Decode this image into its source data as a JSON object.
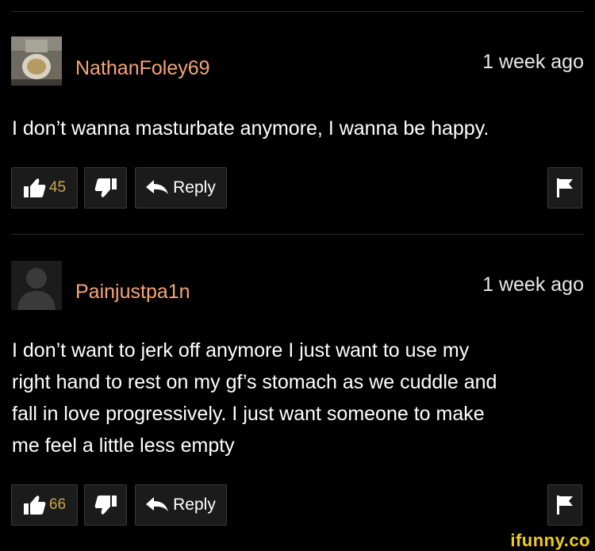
{
  "comments": [
    {
      "username": "NathanFoley69",
      "timestamp": "1 week ago",
      "text": "I don’t wanna masturbate anymore, I wanna be happy.",
      "likes": "45",
      "reply_label": "Reply"
    },
    {
      "username": "Painjustpa1n",
      "timestamp": "1 week ago",
      "text_lines": [
        "I don’t want to jerk off anymore I just want to use my",
        "right hand to rest on my gf’s stomach as we cuddle and",
        "fall in love progressively. I just want someone to make",
        "me feel a little less empty"
      ],
      "likes": "66",
      "reply_label": "Reply"
    }
  ],
  "watermark": "ifunny.co",
  "colors": {
    "background": "#000000",
    "username": "#f5a678",
    "like_count": "#c9a54a",
    "watermark": "#f1cc1c"
  },
  "icons": [
    "thumbs-up-icon",
    "thumbs-down-icon",
    "reply-arrow-icon",
    "flag-icon",
    "user-avatar-icon"
  ]
}
